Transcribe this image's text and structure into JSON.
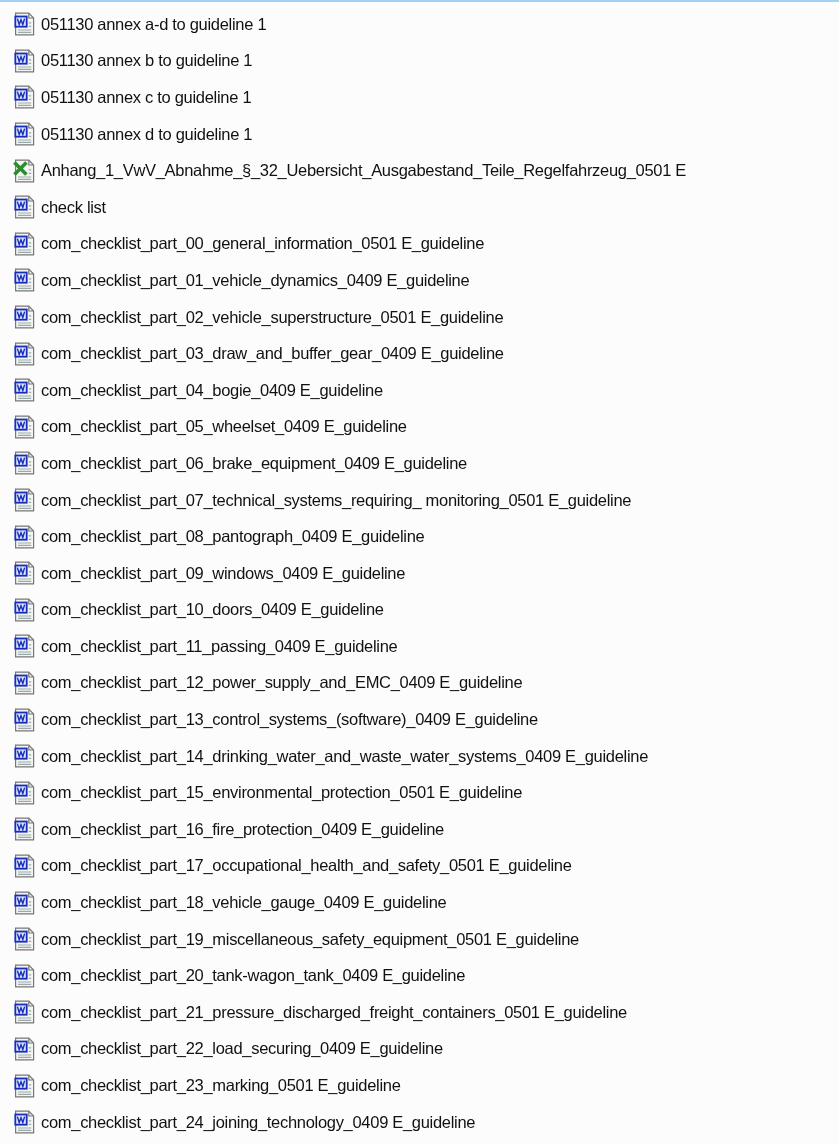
{
  "files": [
    {
      "kind": "word",
      "name": "051130 annex a-d to guideline 1"
    },
    {
      "kind": "word",
      "name": "051130 annex b to guideline 1"
    },
    {
      "kind": "word",
      "name": "051130 annex c to guideline 1"
    },
    {
      "kind": "word",
      "name": "051130 annex d to guideline 1"
    },
    {
      "kind": "excel",
      "name": "Anhang_1_VwV_Abnahme_§_32_Uebersicht_Ausgabestand_Teile_Regelfahrzeug_0501 E"
    },
    {
      "kind": "word",
      "name": "check list"
    },
    {
      "kind": "word",
      "name": "com_checklist_part_00_general_information_0501 E_guideline"
    },
    {
      "kind": "word",
      "name": "com_checklist_part_01_vehicle_dynamics_0409 E_guideline"
    },
    {
      "kind": "word",
      "name": "com_checklist_part_02_vehicle_superstructure_0501 E_guideline"
    },
    {
      "kind": "word",
      "name": "com_checklist_part_03_draw_and_buffer_gear_0409 E_guideline"
    },
    {
      "kind": "word",
      "name": "com_checklist_part_04_bogie_0409 E_guideline"
    },
    {
      "kind": "word",
      "name": "com_checklist_part_05_wheelset_0409 E_guideline"
    },
    {
      "kind": "word",
      "name": "com_checklist_part_06_brake_equipment_0409 E_guideline"
    },
    {
      "kind": "word",
      "name": "com_checklist_part_07_technical_systems_requiring_ monitoring_0501 E_guideline"
    },
    {
      "kind": "word",
      "name": "com_checklist_part_08_pantograph_0409 E_guideline"
    },
    {
      "kind": "word",
      "name": "com_checklist_part_09_windows_0409 E_guideline"
    },
    {
      "kind": "word",
      "name": "com_checklist_part_10_doors_0409 E_guideline"
    },
    {
      "kind": "word",
      "name": "com_checklist_part_11_passing_0409 E_guideline"
    },
    {
      "kind": "word",
      "name": "com_checklist_part_12_power_supply_and_EMC_0409 E_guideline"
    },
    {
      "kind": "word",
      "name": "com_checklist_part_13_control_systems_(software)_0409 E_guideline"
    },
    {
      "kind": "word",
      "name": "com_checklist_part_14_drinking_water_and_waste_water_systems_0409 E_guideline"
    },
    {
      "kind": "word",
      "name": "com_checklist_part_15_environmental_protection_0501 E_guideline"
    },
    {
      "kind": "word",
      "name": "com_checklist_part_16_fire_protection_0409 E_guideline"
    },
    {
      "kind": "word",
      "name": "com_checklist_part_17_occupational_health_and_safety_0501 E_guideline"
    },
    {
      "kind": "word",
      "name": "com_checklist_part_18_vehicle_gauge_0409 E_guideline"
    },
    {
      "kind": "word",
      "name": "com_checklist_part_19_miscellaneous_safety_equipment_0501 E_guideline"
    },
    {
      "kind": "word",
      "name": "com_checklist_part_20_tank-wagon_tank_0409 E_guideline"
    },
    {
      "kind": "word",
      "name": "com_checklist_part_21_pressure_discharged_freight_containers_0501 E_guideline"
    },
    {
      "kind": "word",
      "name": "com_checklist_part_22_load_securing_0409 E_guideline"
    },
    {
      "kind": "word",
      "name": "com_checklist_part_23_marking_0501 E_guideline"
    },
    {
      "kind": "word",
      "name": "com_checklist_part_24_joining_technology_0409 E_guideline"
    }
  ]
}
